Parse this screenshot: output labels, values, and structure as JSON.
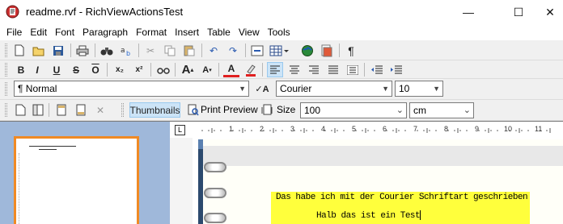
{
  "window": {
    "title": "readme.rvf - RichViewActionsTest",
    "minimize": "—",
    "maximize": "☐",
    "close": "✕"
  },
  "menu": [
    "File",
    "Edit",
    "Font",
    "Paragraph",
    "Format",
    "Insert",
    "Table",
    "View",
    "Tools"
  ],
  "format_toolbar": {
    "paragraph_style": "¶ Normal",
    "font_name": "Courier",
    "font_size": "10"
  },
  "view_toolbar": {
    "thumbnails_label": "Thumbnails",
    "print_preview_label": "Print Preview",
    "size_label": "Size",
    "size_value": "100",
    "unit_value": "cm"
  },
  "ruler": {
    "labels": [
      "1",
      "2",
      "3",
      "4",
      "5",
      "6",
      "7",
      "8",
      "9",
      "10",
      "11"
    ]
  },
  "document": {
    "line1": "Das habe ich mit der Courier Schriftart geschrieben",
    "line2": "Halb das ist ein Test"
  },
  "icons": {
    "app": "app-logo-icon",
    "toolbar1": [
      "new-icon",
      "open-icon",
      "save-icon",
      "print-icon",
      "find-icon",
      "replace-icon",
      "cut-icon",
      "copy-icon",
      "paste-icon",
      "undo-icon",
      "redo-icon",
      "hyperlink-icon",
      "table-icon",
      "picture-icon",
      "object-icon",
      "pilcrow-icon"
    ],
    "toolbar2": [
      "bold-icon",
      "italic-icon",
      "underline-icon",
      "strikeout-icon",
      "overline-icon",
      "subscript-icon",
      "superscript-icon",
      "spell-icon",
      "grow-font-icon",
      "shrink-font-icon",
      "font-color-icon",
      "highlight-icon",
      "align-left-icon",
      "align-center-icon",
      "align-right-icon",
      "justify-icon",
      "list-icon",
      "indent-decrease-icon",
      "indent-increase-icon"
    ]
  },
  "colors": {
    "accent": "#f08a24",
    "highlight": "#ffff3c",
    "panel": "#9fb8da"
  }
}
